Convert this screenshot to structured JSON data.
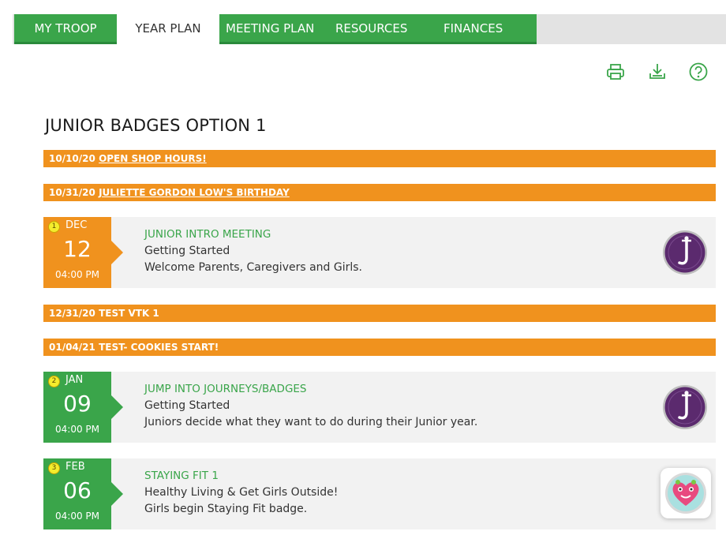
{
  "nav": {
    "tabs": [
      {
        "label": "MY TROOP",
        "active": false
      },
      {
        "label": "YEAR PLAN",
        "active": true
      },
      {
        "label": "MEETING PLAN",
        "active": false
      },
      {
        "label": "RESOURCES",
        "active": false
      },
      {
        "label": "FINANCES",
        "active": false
      }
    ]
  },
  "toolbar": {
    "icons": [
      "print-icon",
      "download-icon",
      "help-icon"
    ]
  },
  "plan": {
    "title": "JUNIOR BADGES OPTION 1"
  },
  "events": [
    {
      "date": "10/10/20",
      "name": "OPEN SHOP HOURS!"
    },
    {
      "date": "10/31/20",
      "name": "JULIETTE GORDON LOW'S BIRTHDAY"
    },
    {
      "date": "12/31/20",
      "name": "TEST VTK 1"
    },
    {
      "date": "01/04/21",
      "name": "TEST- COOKIES START!"
    }
  ],
  "meetings": [
    {
      "number": "1",
      "month": "DEC",
      "day": "12",
      "time": "04:00 PM",
      "title": "JUNIOR INTRO MEETING",
      "subtitle": "Getting Started",
      "description": "Welcome Parents, Caregivers and Girls.",
      "badge": "junior-logo-icon"
    },
    {
      "number": "2",
      "month": "JAN",
      "day": "09",
      "time": "04:00 PM",
      "title": "JUMP INTO JOURNEYS/BADGES",
      "subtitle": "Getting Started",
      "description": "Juniors decide what they want to do during their Junior year.",
      "badge": "junior-logo-icon"
    },
    {
      "number": "3",
      "month": "FEB",
      "day": "06",
      "time": "04:00 PM",
      "title": "STAYING FIT 1",
      "subtitle": "Healthy Living & Get Girls Outside!",
      "description": "Girls begin Staying Fit badge.",
      "badge": "staying-fit-badge-icon"
    }
  ],
  "colors": {
    "green": "#3aa54a",
    "orange": "#f0921e",
    "badge_purple": "#5b2a6e",
    "number_yellow": "#f4ec2d"
  }
}
